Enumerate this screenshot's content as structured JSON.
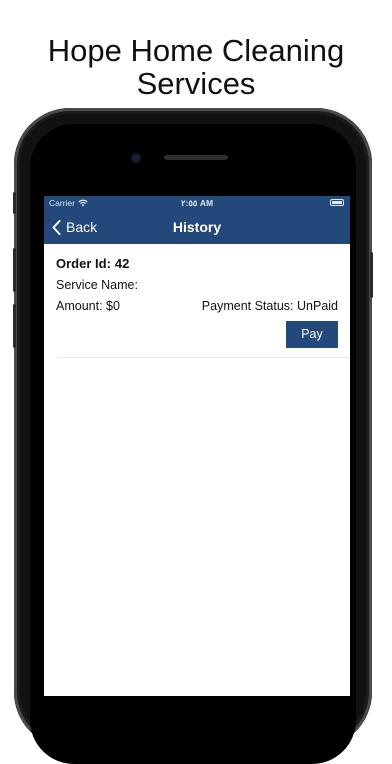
{
  "promo": {
    "title": "Hope Home Cleaning\nServices"
  },
  "status_bar": {
    "carrier": "Carrier",
    "time": "٢:٥٥ AM"
  },
  "nav": {
    "back_label": "Back",
    "title": "History"
  },
  "order": {
    "id_label": "Order Id:",
    "id_value": "42",
    "service_label": "Service Name:",
    "amount_label": "Amount:",
    "amount_value": "$0",
    "payment_status_label": "Payment Status:",
    "payment_status_value": "UnPaid",
    "pay_label": "Pay"
  },
  "colors": {
    "primary": "#23497a",
    "background": "#ffffff"
  }
}
